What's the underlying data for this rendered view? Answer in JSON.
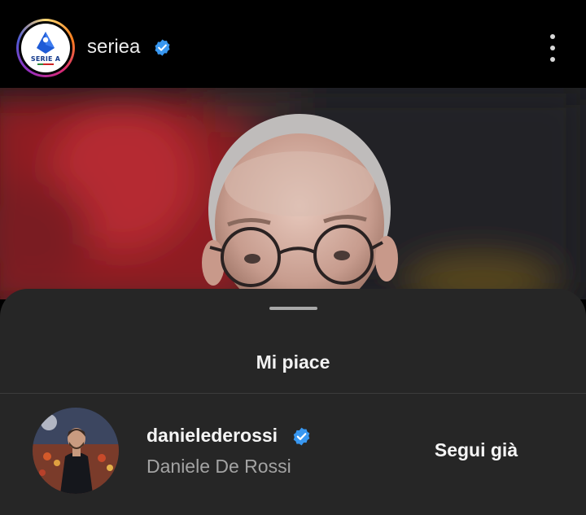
{
  "post": {
    "account": {
      "username": "seriea",
      "verified": true,
      "logo_text": "SERIE A",
      "avatar_icon": "serie-a-logo"
    },
    "menu_icon": "more-vertical-icon"
  },
  "likes_sheet": {
    "title": "Mi piace",
    "likers": [
      {
        "username": "danielederossi",
        "full_name": "Daniele De Rossi",
        "verified": true,
        "follow_label": "Segui già"
      }
    ]
  },
  "colors": {
    "verified_badge": "#3897f0",
    "sheet_background": "#262626",
    "header_background": "#000000"
  }
}
